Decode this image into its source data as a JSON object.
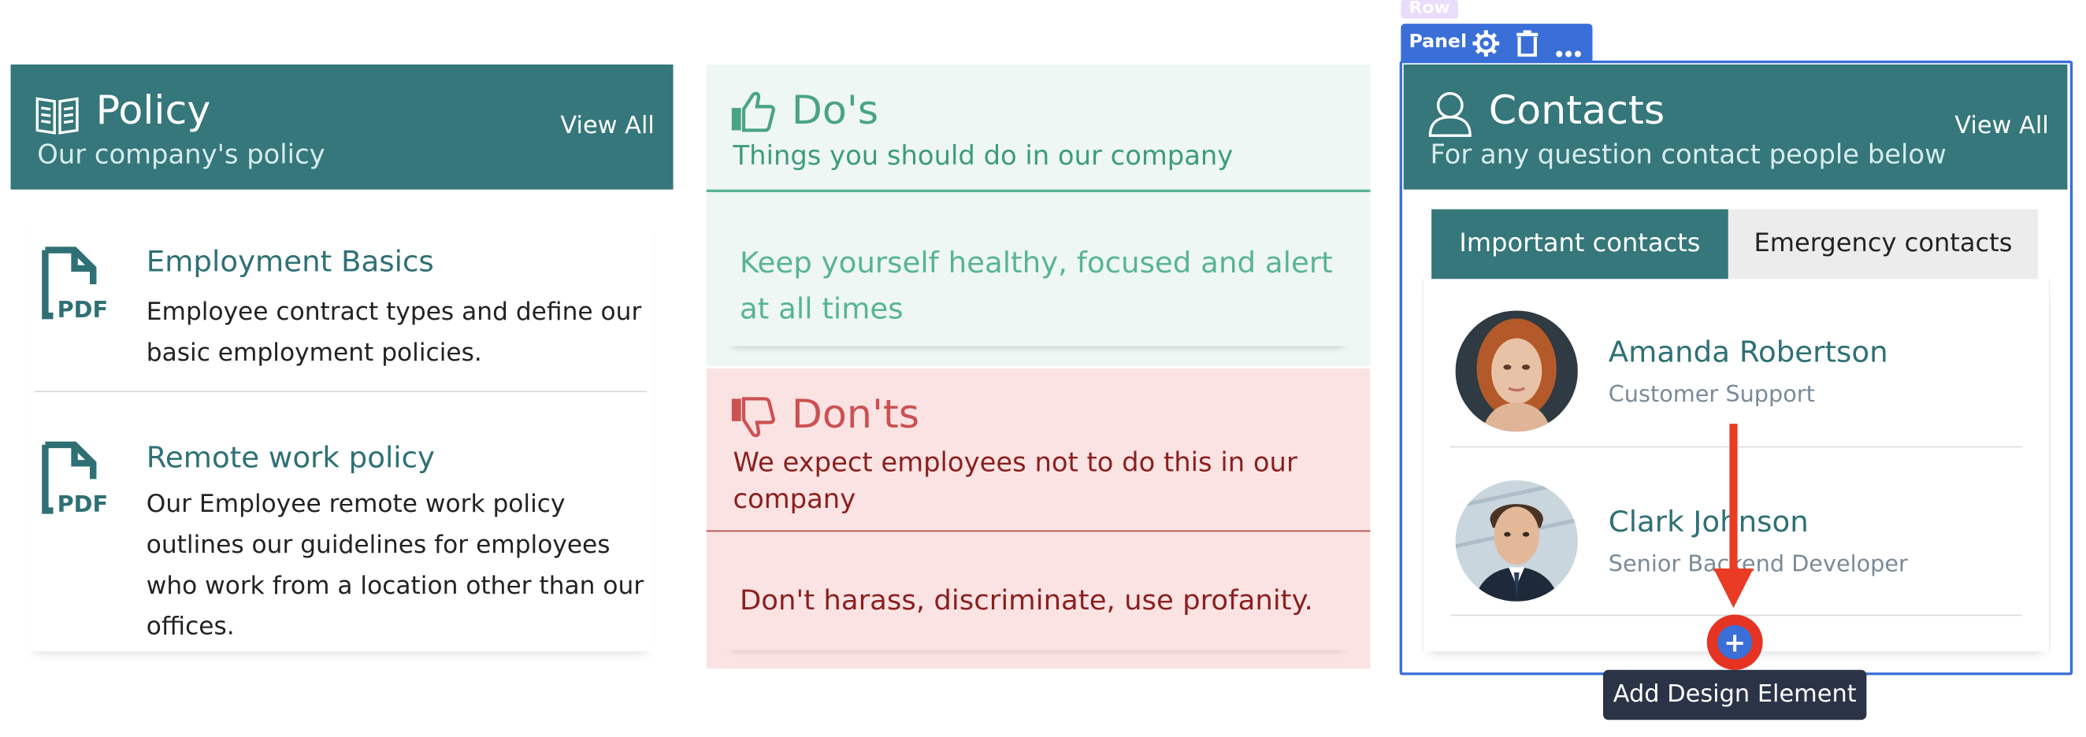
{
  "policy": {
    "title": "Policy",
    "subtitle": "Our company's policy",
    "view_all": "View All",
    "items": [
      {
        "title": "Employment Basics",
        "description": "Employee contract types and define our basic employment policies.",
        "icon": "pdf-icon"
      },
      {
        "title": "Remote work policy",
        "description": "Our Employee remote work policy outlines our guidelines for employees who work from a location other than our offices.",
        "icon": "pdf-icon"
      }
    ],
    "pdf_label": "PDF",
    "color": "#35777b"
  },
  "dos": {
    "title": "Do's",
    "subtitle": "Things you should do in our company",
    "body": "Keep yourself healthy, focused and alert at all times",
    "color": "#58b493"
  },
  "donts": {
    "title": "Don'ts",
    "subtitle": "We expect employees not to do this in our company",
    "body": "Don't harass, discriminate, use profanity.",
    "color": "#cc5151"
  },
  "editor": {
    "row_tag": "Row",
    "panel_label": "Panel",
    "add_element_tooltip": "Add Design Element",
    "accent": "#3a6fd8"
  },
  "contacts": {
    "title": "Contacts",
    "subtitle": "For any question contact people below",
    "view_all": "View All",
    "tabs": [
      {
        "label": "Important contacts",
        "active": true
      },
      {
        "label": "Emergency contacts",
        "active": false
      }
    ],
    "people": [
      {
        "name": "Amanda Robertson",
        "role": "Customer Support"
      },
      {
        "name": "Clark Johnson",
        "role": "Senior Backend Developer"
      }
    ]
  }
}
